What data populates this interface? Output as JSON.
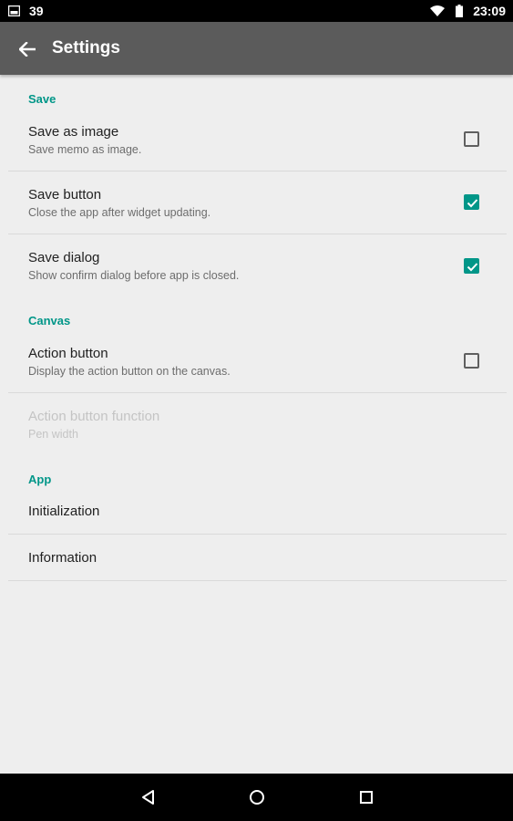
{
  "status_bar": {
    "notification_count": "39",
    "time": "23:09",
    "icons": [
      "gallery-notification-icon",
      "wifi-icon",
      "battery-icon"
    ]
  },
  "app_bar": {
    "title": "Settings",
    "back_icon": "arrow-back-icon"
  },
  "colors": {
    "accent": "#009688",
    "app_bar": "#5b5b5b",
    "background": "#eeeeee"
  },
  "sections": {
    "save": {
      "header": "Save",
      "items": [
        {
          "title": "Save as image",
          "summary": "Save memo as image.",
          "checked": false
        },
        {
          "title": "Save button",
          "summary": "Close the app after widget updating.",
          "checked": true
        },
        {
          "title": "Save dialog",
          "summary": "Show confirm dialog before app is closed.",
          "checked": true
        }
      ]
    },
    "canvas": {
      "header": "Canvas",
      "items": [
        {
          "title": "Action button",
          "summary": "Display the action button on the canvas.",
          "checked": false
        },
        {
          "title": "Action button function",
          "summary": "Pen width",
          "enabled": false
        }
      ]
    },
    "app": {
      "header": "App",
      "items": [
        {
          "title": "Initialization"
        },
        {
          "title": "Information"
        }
      ]
    }
  },
  "nav_bar": {
    "icons": [
      "back-triangle-icon",
      "home-circle-icon",
      "recents-square-icon"
    ]
  }
}
